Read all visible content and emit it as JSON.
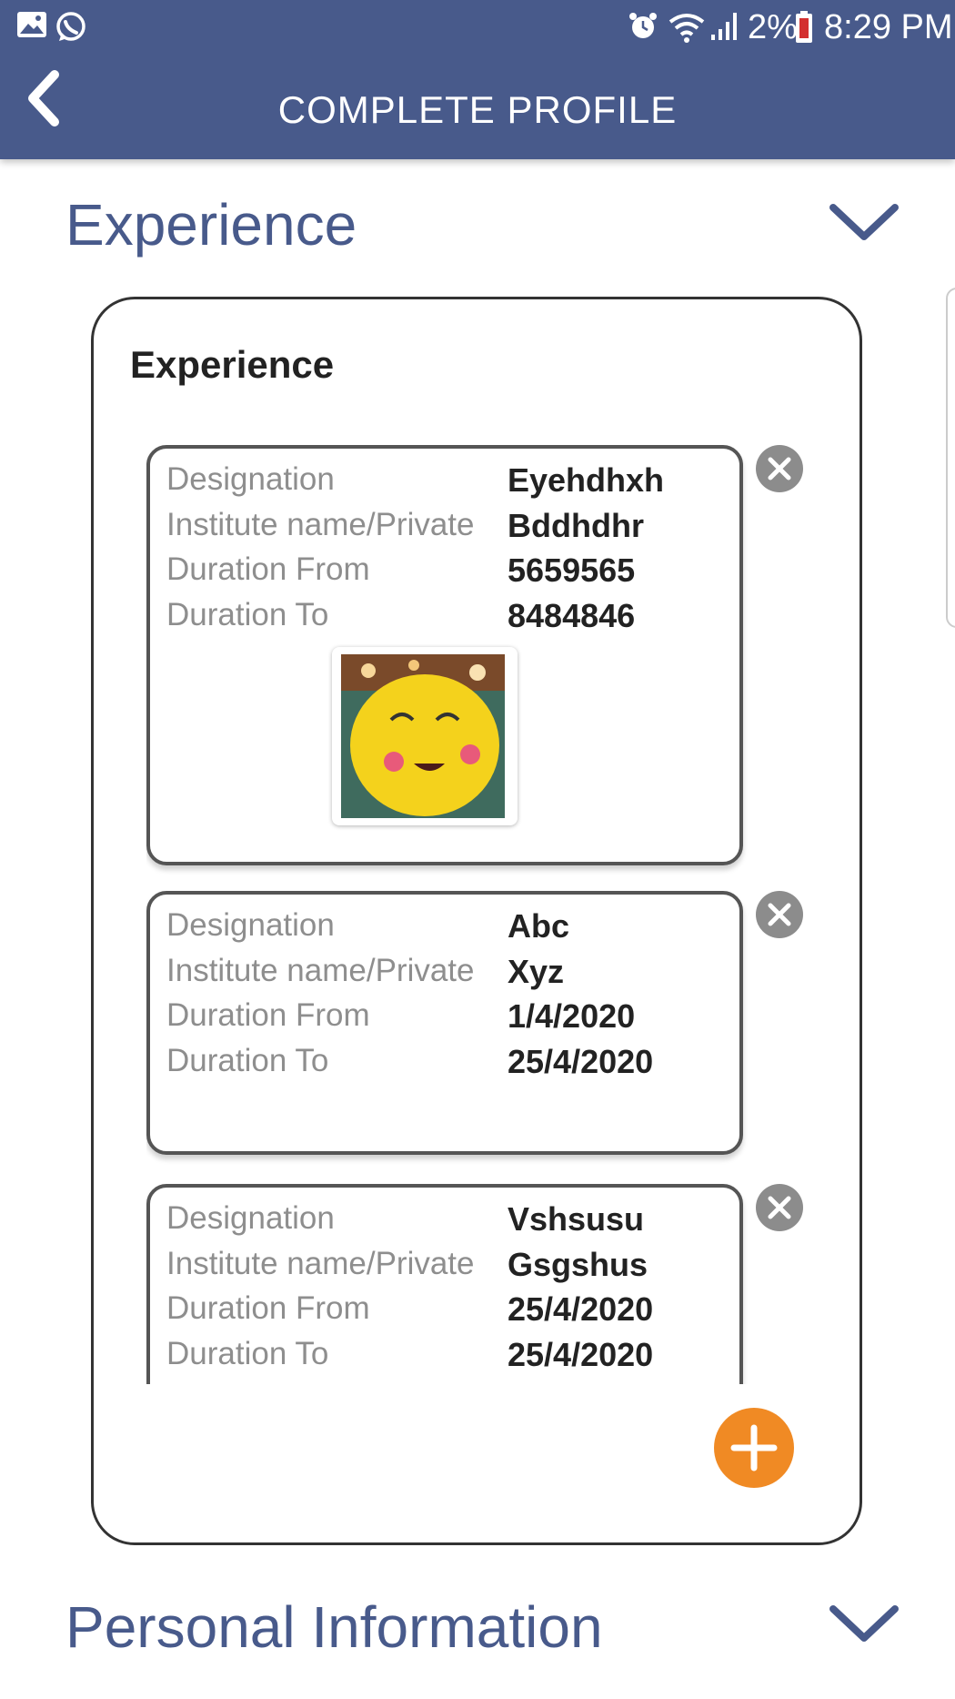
{
  "status_bar": {
    "battery_percent": "2%",
    "time": "8:29 PM",
    "icons": [
      "gallery-icon",
      "whatsapp-icon",
      "alarm-icon",
      "wifi-icon",
      "signal-icon",
      "battery-icon"
    ]
  },
  "app_bar": {
    "title": "COMPLETE PROFILE",
    "back_icon": "back-arrow-icon"
  },
  "colors": {
    "primary": "#485a8b",
    "fab": "#f08a24",
    "label": "#8e8e8e",
    "value": "#222222"
  },
  "sections": {
    "experience": {
      "title": "Experience",
      "expanded": true
    },
    "personal": {
      "title": "Personal Information",
      "expanded": false
    }
  },
  "experience_card": {
    "title": "Experience",
    "labels": {
      "designation": "Designation",
      "institute": "Institute name/Private",
      "from": "Duration From",
      "to": "Duration To"
    },
    "items": [
      {
        "designation": "Eyehdhxh",
        "institute": "Bddhdhr",
        "from": "5659565",
        "to": "8484846",
        "has_image": true,
        "image": "smiling-emoji-pillow-photo"
      },
      {
        "designation": "Abc",
        "institute": "Xyz",
        "from": "1/4/2020",
        "to": "25/4/2020",
        "has_image": false
      },
      {
        "designation": "Vshsusu",
        "institute": "Gsgshus",
        "from": "25/4/2020",
        "to": "25/4/2020",
        "has_image": false
      }
    ],
    "add_icon": "plus-icon",
    "remove_icon": "close-icon"
  }
}
